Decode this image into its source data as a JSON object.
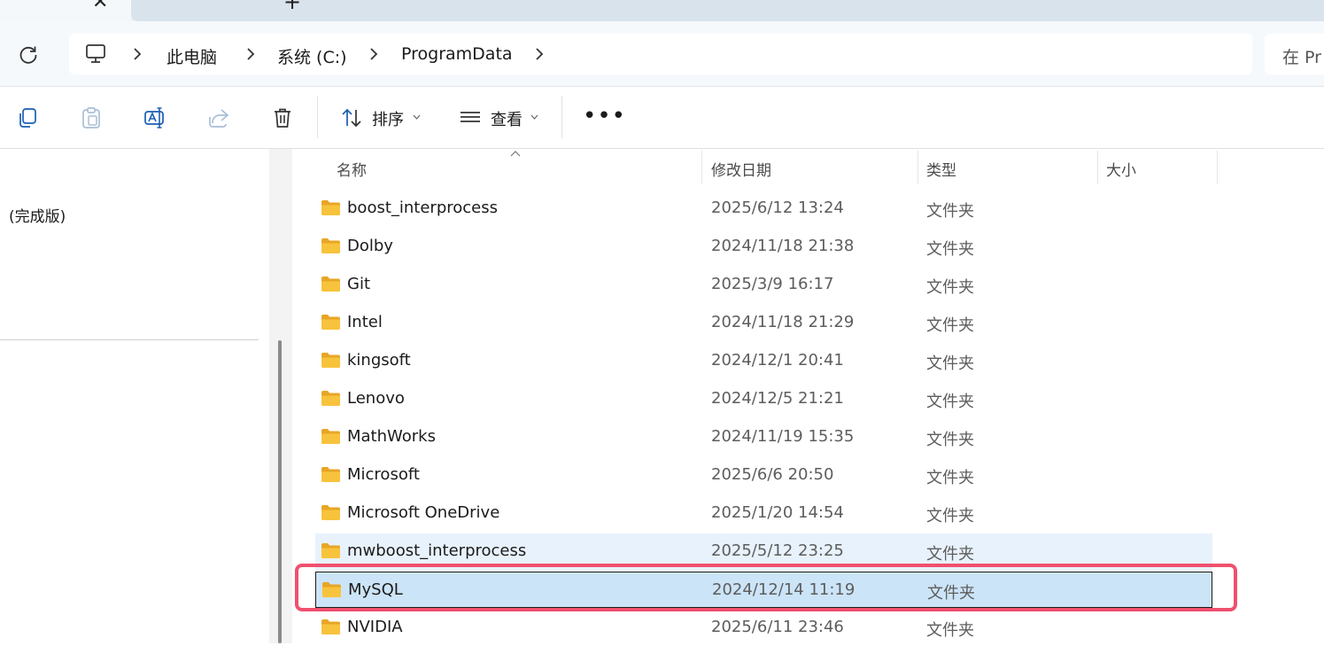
{
  "tabs": {
    "close_glyph": "✕",
    "new_tab_glyph": "+"
  },
  "address_bar": {
    "crumbs": [
      "此电脑",
      "系统 (C:)",
      "ProgramData"
    ],
    "search_placeholder": "在 Pr"
  },
  "toolbar": {
    "sort_label": "排序",
    "view_label": "查看",
    "more_glyph": "•••"
  },
  "nav": {
    "item_label": "(完成版)"
  },
  "columns": {
    "name": "名称",
    "date": "修改日期",
    "type": "类型",
    "size": "大小"
  },
  "rows": [
    {
      "name": "boost_interprocess",
      "date": "2025/6/12 13:24",
      "type": "文件夹"
    },
    {
      "name": "Dolby",
      "date": "2024/11/18 21:38",
      "type": "文件夹"
    },
    {
      "name": "Git",
      "date": "2025/3/9 16:17",
      "type": "文件夹"
    },
    {
      "name": "Intel",
      "date": "2024/11/18 21:29",
      "type": "文件夹"
    },
    {
      "name": "kingsoft",
      "date": "2024/12/1 20:41",
      "type": "文件夹"
    },
    {
      "name": "Lenovo",
      "date": "2024/12/5 21:21",
      "type": "文件夹"
    },
    {
      "name": "MathWorks",
      "date": "2024/11/19 15:35",
      "type": "文件夹"
    },
    {
      "name": "Microsoft",
      "date": "2025/6/6 20:50",
      "type": "文件夹"
    },
    {
      "name": "Microsoft OneDrive",
      "date": "2025/1/20 14:54",
      "type": "文件夹"
    },
    {
      "name": "mwboost_interprocess",
      "date": "2025/5/12 23:25",
      "type": "文件夹"
    },
    {
      "name": "MySQL",
      "date": "2024/12/14 11:19",
      "type": "文件夹"
    },
    {
      "name": "NVIDIA",
      "date": "2025/6/11 23:46",
      "type": "文件夹"
    }
  ],
  "colors": {
    "accent_highlight": "#f0506e",
    "selected_row": "#cce4f7",
    "hover_row": "#e8f2fc",
    "folder": "#f8c33c"
  },
  "state": {
    "hover_row": "mwboost_interprocess",
    "selected_row": "MySQL"
  }
}
